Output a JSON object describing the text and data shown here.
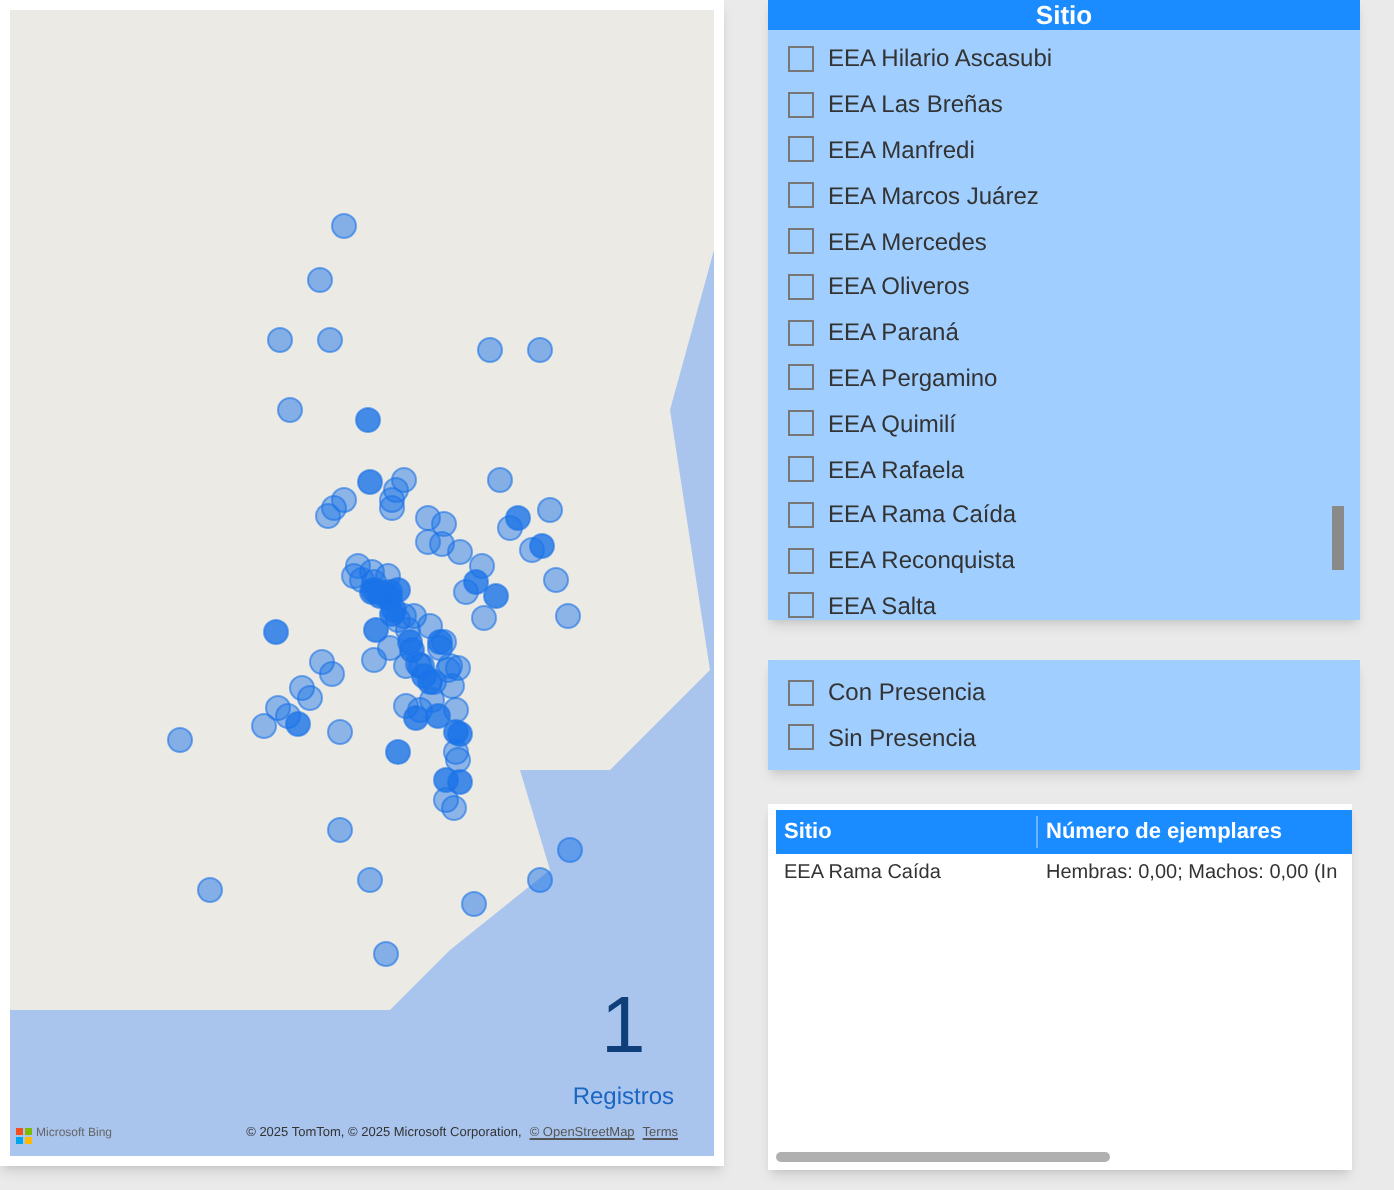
{
  "map": {
    "attribution": "© 2025 TomTom, © 2025 Microsoft Corporation,",
    "attribution_link": "© OpenStreetMap",
    "terms_link": "Terms",
    "logo_text": "Microsoft Bing",
    "card": {
      "value": "1",
      "label": "Registros"
    }
  },
  "site_slicer": {
    "title": "Sitio",
    "items": [
      {
        "label": "EEA Hilario Ascasubi",
        "checked": false
      },
      {
        "label": "EEA Las Breñas",
        "checked": false
      },
      {
        "label": "EEA Manfredi",
        "checked": false
      },
      {
        "label": "EEA Marcos Juárez",
        "checked": false
      },
      {
        "label": "EEA Mercedes",
        "checked": false
      },
      {
        "label": "EEA Oliveros",
        "checked": false
      },
      {
        "label": "EEA Paraná",
        "checked": false
      },
      {
        "label": "EEA Pergamino",
        "checked": false
      },
      {
        "label": "EEA Quimilí",
        "checked": false
      },
      {
        "label": "EEA Rafaela",
        "checked": false
      },
      {
        "label": "EEA Rama Caída",
        "checked": false
      },
      {
        "label": "EEA Reconquista",
        "checked": false
      },
      {
        "label": "EEA Salta",
        "checked": false
      }
    ]
  },
  "presence_slicer": {
    "items": [
      {
        "label": "Con Presencia",
        "checked": false
      },
      {
        "label": "Sin Presencia",
        "checked": false
      }
    ]
  },
  "table": {
    "columns": [
      "Sitio",
      "Número de ejemplares"
    ],
    "rows": [
      [
        "EEA Rama Caída",
        "Hembras: 0,00; Machos: 0,00 (In"
      ]
    ]
  }
}
